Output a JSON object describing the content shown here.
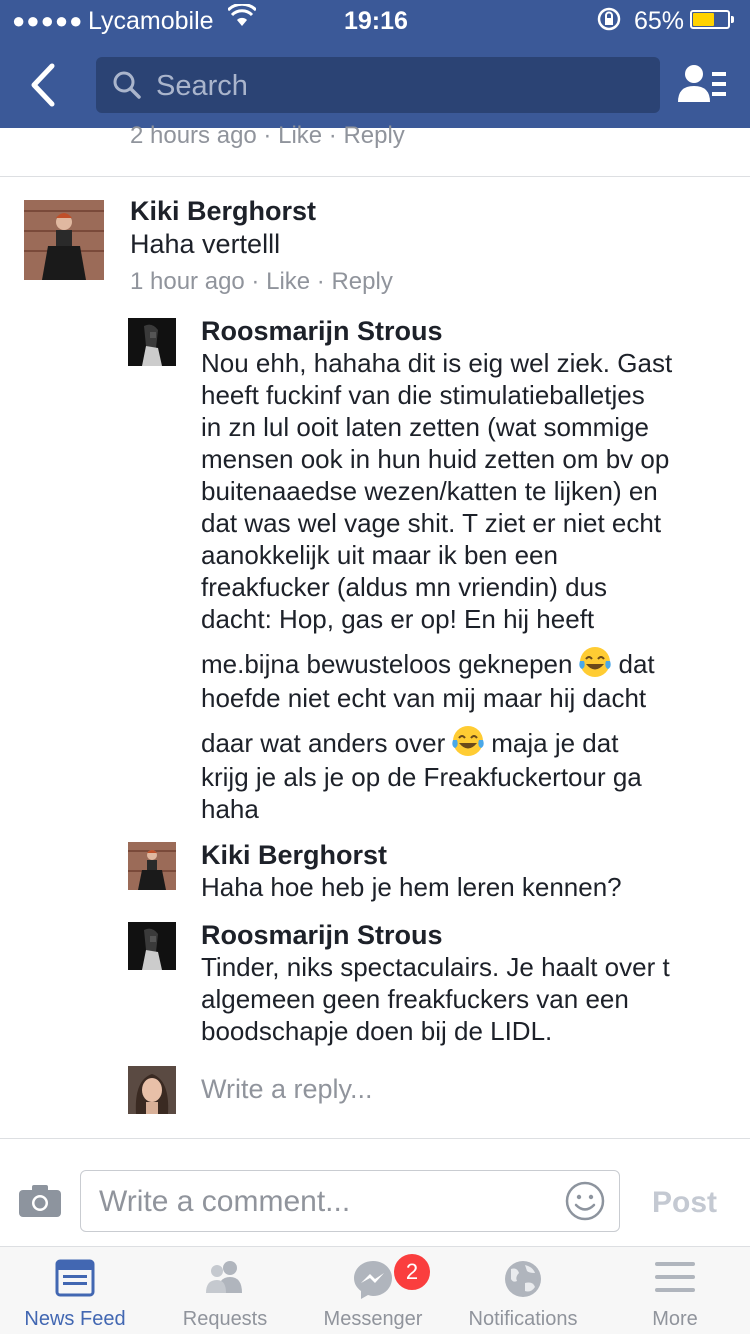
{
  "status_bar": {
    "signal_dots": "●●●●●",
    "carrier": "Lycamobile",
    "time": "19:16",
    "battery_percent": "65%",
    "battery_level": 0.65,
    "icons": [
      "wifi-icon",
      "rotation-lock-icon",
      "battery-icon"
    ]
  },
  "header": {
    "search_placeholder": "Search",
    "icons": [
      "back-arrow-icon",
      "search-icon",
      "friends-icon"
    ]
  },
  "previous_meta": "2 hours ago · Like · Reply",
  "comment": {
    "author": "Kiki Berghorst",
    "text": "Haha vertelll",
    "time": "1 hour ago",
    "like_label": "Like",
    "reply_label": "Reply"
  },
  "replies": [
    {
      "author": "Roosmarijn Strous",
      "lines": [
        "Nou ehh, hahaha dit is eig wel ziek. Gast",
        "heeft fuckinf van die stimulatieballetjes",
        "in zn lul ooit laten zetten (wat sommige",
        "mensen ook in hun huid zetten om bv op",
        "buitenaaedse wezen/katten te lijken) en",
        "dat was wel vage shit. T ziet er niet echt",
        "aanokkelijk uit maar ik ben een",
        "freakfucker (aldus mn vriendin) dus",
        "dacht: Hop, gas er op! En hij heeft"
      ],
      "line_a_before": "me.bijna bewusteloos geknepen",
      "line_a_after": "dat",
      "line_b": "hoefde niet echt van mij maar hij dacht",
      "line_c_before": "daar wat anders over",
      "line_c_after": "maja je dat",
      "line_d": "krijg je als je op de Freakfuckertour ga",
      "line_e": "haha"
    },
    {
      "author": "Kiki Berghorst",
      "text": "Haha hoe heb je hem leren kennen?"
    },
    {
      "author": "Roosmarijn Strous",
      "lines": [
        "Tinder, niks spectaculairs. Je haalt over t",
        "algemeen geen freakfuckers van een",
        "boodschapje doen bij de LIDL."
      ]
    }
  ],
  "write_reply_placeholder": "Write a reply...",
  "composer": {
    "placeholder": "Write a comment...",
    "post_label": "Post"
  },
  "tabs": [
    {
      "label": "News Feed",
      "icon": "news-feed-icon",
      "active": true
    },
    {
      "label": "Requests",
      "icon": "requests-icon",
      "active": false
    },
    {
      "label": "Messenger",
      "icon": "messenger-icon",
      "active": false,
      "badge": "2"
    },
    {
      "label": "Notifications",
      "icon": "globe-icon",
      "active": false
    },
    {
      "label": "More",
      "icon": "menu-icon",
      "active": false
    }
  ],
  "colors": {
    "header": "#3b5998",
    "search_bg": "#2b4374",
    "active_tab": "#4267b2",
    "meta_text": "#90949c",
    "badge": "#fa3e3e"
  }
}
